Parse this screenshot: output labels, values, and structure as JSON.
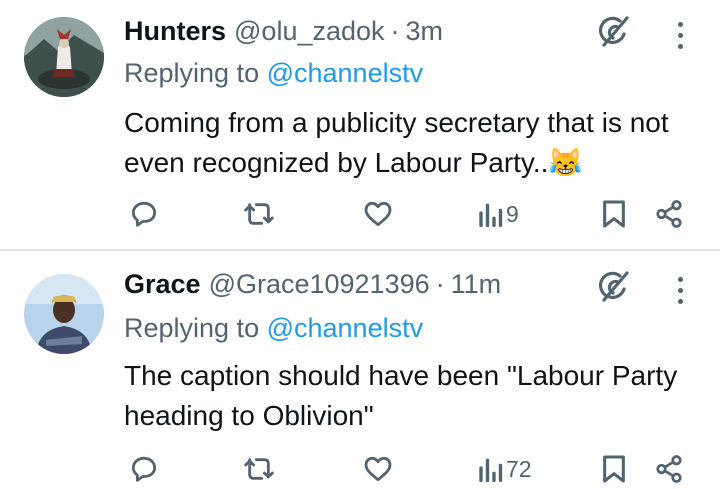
{
  "tweets": [
    {
      "name": "Hunters",
      "handle": "@olu_zadok",
      "dot": "·",
      "time": "3m",
      "replying_prefix": "Replying to ",
      "replying_to": "@channelstv",
      "body": "Coming from a publicity secretary that is not even recognized by Labour Party..",
      "emoji": "😹",
      "views": "9"
    },
    {
      "name": "Grace",
      "handle": "@Grace10921396",
      "dot": "·",
      "time": "11m",
      "replying_prefix": "Replying to ",
      "replying_to": "@channelstv",
      "body": "The caption should have been \"Labour Party heading to Oblivion\"",
      "views": "72"
    }
  ],
  "icons": {
    "reply": "reply-icon",
    "retweet": "retweet-icon",
    "like": "heart-icon",
    "views": "views-chart-icon",
    "bookmark": "bookmark-icon",
    "share": "share-icon",
    "grok": "grok-icon",
    "more": "more-vertical-icon"
  },
  "colors": {
    "link": "#1d9bf0",
    "secondary_text": "#536471",
    "primary_text": "#0f1419",
    "divider": "#e3e7ea"
  }
}
